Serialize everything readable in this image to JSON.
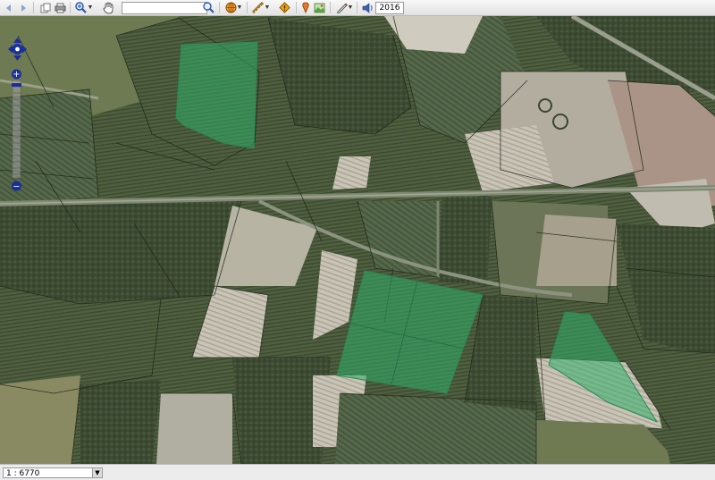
{
  "toolbar": {
    "search": {
      "value": "",
      "placeholder": ""
    },
    "year": "2016",
    "icons": [
      "nav-back-icon",
      "nav-forward-icon",
      "copy-icon",
      "print-icon",
      "zoom-icon",
      "pan-hand-icon",
      "search-icon",
      "layers-globe-icon",
      "measure-icon",
      "warning-sign-icon",
      "pin-icon",
      "image-icon",
      "draw-pen-icon",
      "sound-icon"
    ]
  },
  "map_controls": {
    "zoom_in": "+",
    "zoom_out": "−"
  },
  "statusbar": {
    "scale": "1 : 6770"
  },
  "colors": {
    "highlight": "#2fae6a",
    "toolbar": "#e9e9e9",
    "nav": "#1a2f9a"
  }
}
